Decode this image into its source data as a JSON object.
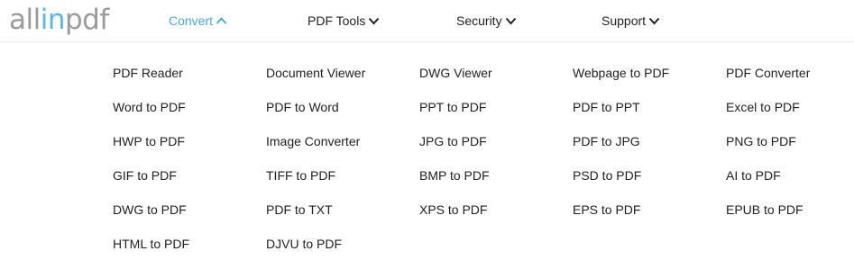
{
  "logo": {
    "part1": "all",
    "part2": "in",
    "part3": "pdf"
  },
  "nav": {
    "convert": "Convert",
    "pdf_tools": "PDF Tools",
    "security": "Security",
    "support": "Support"
  },
  "colors": {
    "accent": "#4aa8d8",
    "logo_grey": "#9b9b9b",
    "logo_blue": "#5bb6e8"
  },
  "menu": {
    "columns": [
      [
        "PDF Reader",
        "Word to PDF",
        "HWP to PDF",
        "GIF to PDF",
        "DWG to PDF",
        "HTML to PDF"
      ],
      [
        "Document Viewer",
        "PDF to Word",
        "Image Converter",
        "TIFF to PDF",
        "PDF to TXT",
        "DJVU to PDF"
      ],
      [
        "DWG Viewer",
        "PPT to PDF",
        "JPG to PDF",
        "BMP to PDF",
        "XPS to PDF"
      ],
      [
        "Webpage to PDF",
        "PDF to PPT",
        "PDF to JPG",
        "PSD to PDF",
        "EPS to PDF"
      ],
      [
        "PDF Converter",
        "Excel to PDF",
        "PNG to PDF",
        "AI to PDF",
        "EPUB to PDF"
      ]
    ]
  }
}
